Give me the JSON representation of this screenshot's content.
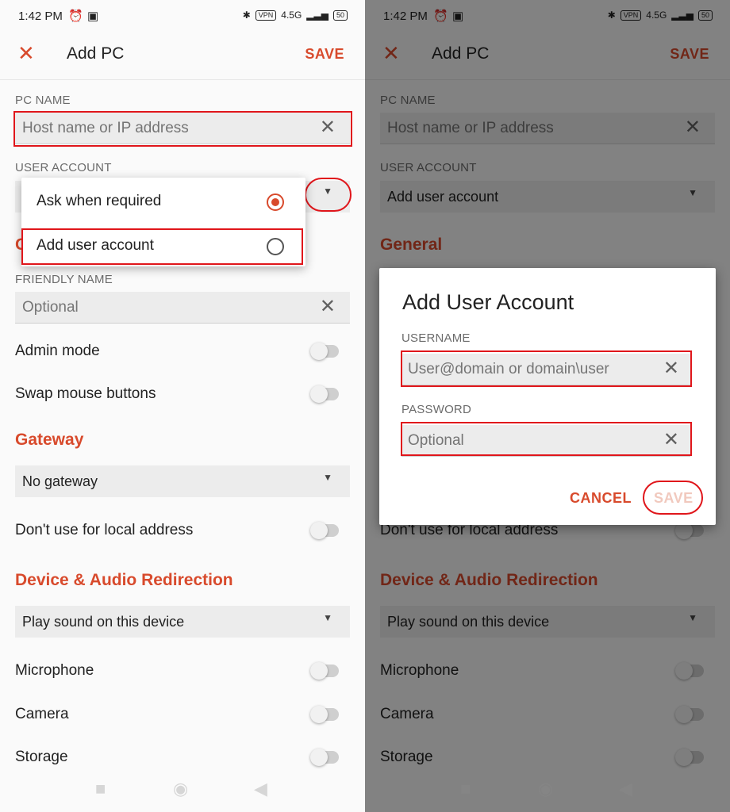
{
  "status_bar": {
    "time": "1:42 PM",
    "vpn": "VPN",
    "network": "4.5G",
    "battery": "50"
  },
  "app_bar": {
    "title": "Add PC",
    "save_label": "SAVE"
  },
  "pc_name": {
    "label": "PC NAME",
    "placeholder": "Host name or IP address"
  },
  "user_account": {
    "label": "USER ACCOUNT",
    "selected": "Add user account",
    "options": [
      {
        "label": "Ask when required",
        "selected": true
      },
      {
        "label": "Add user account",
        "selected": false
      }
    ]
  },
  "general": {
    "heading": "General"
  },
  "friendly_name": {
    "label": "FRIENDLY NAME",
    "placeholder": "Optional"
  },
  "toggles_top": [
    {
      "label": "Admin mode",
      "on": false
    },
    {
      "label": "Swap mouse buttons",
      "on": false
    }
  ],
  "gateway": {
    "heading": "Gateway",
    "selected": "No gateway",
    "local_toggle_label": "Don't use for local address"
  },
  "device_audio": {
    "heading": "Device & Audio Redirection",
    "sound_selected": "Play sound on this device",
    "toggles": [
      {
        "label": "Microphone",
        "on": false
      },
      {
        "label": "Camera",
        "on": false
      },
      {
        "label": "Storage",
        "on": false
      }
    ]
  },
  "dialog": {
    "title": "Add User Account",
    "username_label": "USERNAME",
    "username_placeholder": "User@domain or domain\\user",
    "password_label": "PASSWORD",
    "password_placeholder": "Optional",
    "cancel_label": "CANCEL",
    "save_label": "SAVE"
  },
  "colors": {
    "accent": "#d84a2c",
    "annotation": "#e0161b"
  }
}
